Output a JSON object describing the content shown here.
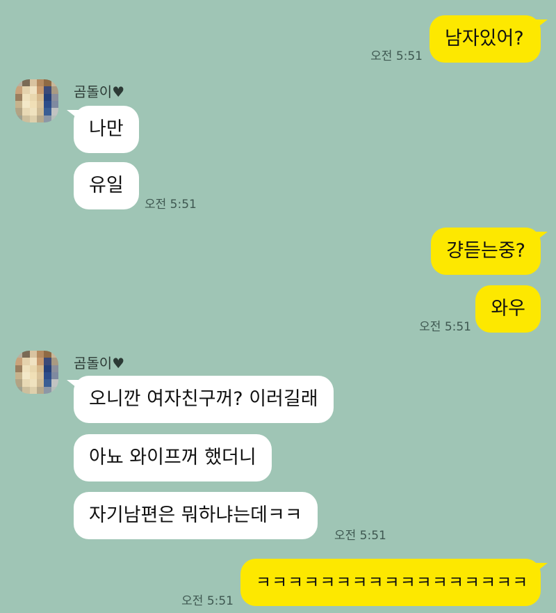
{
  "colors": {
    "background": "#9fc5b5",
    "outgoing_bubble": "#fde800",
    "incoming_bubble": "#ffffff",
    "timestamp_text": "#3e5750"
  },
  "messages": {
    "m1": {
      "text": "남자있어?",
      "time": "오전 5:51"
    },
    "group1": {
      "sender": "곰돌이♥",
      "m1": "나만",
      "m2": "유일",
      "time": "오전 5:51"
    },
    "m2": {
      "text": "걍듣는중?"
    },
    "m3": {
      "text": "와우",
      "time": "오전 5:51"
    },
    "group2": {
      "sender": "곰돌이♥",
      "m1": "오니깐 여자친구꺼? 이러길래",
      "m2": "아뇨 와이프꺼 했더니",
      "m3": "자기남편은 뭐하냐는데ㅋㅋ",
      "time": "오전 5:51"
    },
    "m4": {
      "text": "ㅋㅋㅋㅋㅋㅋㅋㅋㅋㅋㅋㅋㅋㅋㅋㅋㅋ",
      "time": "오전 5:51"
    }
  },
  "avatar": {
    "icon": "pixelated-profile-photo"
  }
}
